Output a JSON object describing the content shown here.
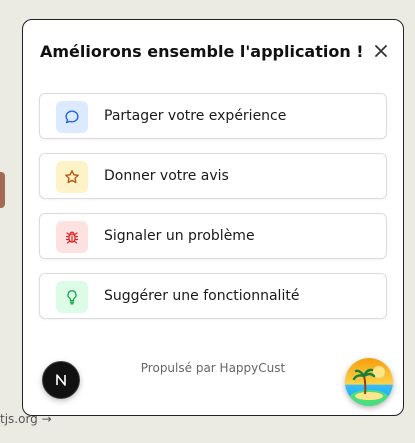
{
  "background": {
    "link_text": "tjs.org →"
  },
  "panel": {
    "title": "Améliorons ensemble l'application !",
    "close_icon": "close-icon",
    "options": [
      {
        "label": "Partager votre expérience",
        "icon": "chat-bubble-icon",
        "icon_bg": "#dbeafe",
        "icon_color": "#2563eb"
      },
      {
        "label": "Donner votre avis",
        "icon": "star-icon",
        "icon_bg": "#fef3c7",
        "icon_color": "#b45309"
      },
      {
        "label": "Signaler un problème",
        "icon": "bug-icon",
        "icon_bg": "#fee2e2",
        "icon_color": "#dc2626"
      },
      {
        "label": "Suggérer une fonctionnalité",
        "icon": "lightbulb-icon",
        "icon_bg": "#dcfce7",
        "icon_color": "#16a34a"
      }
    ],
    "powered_by": "Propulsé par HappyCust"
  },
  "next_badge": {
    "letter": "N",
    "icon": "nextjs-logo-icon"
  },
  "launcher": {
    "icon": "beach-avatar-icon"
  }
}
